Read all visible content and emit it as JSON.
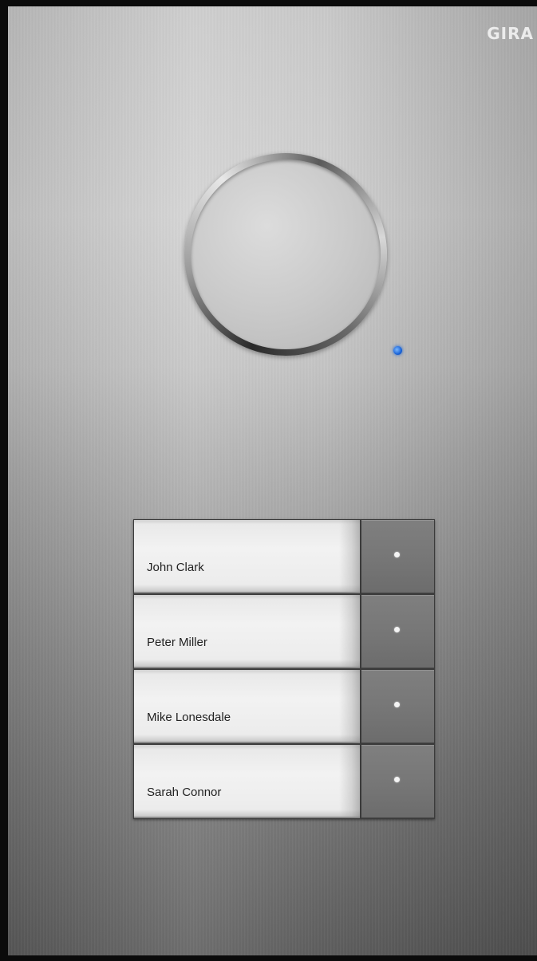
{
  "device": {
    "brand": "GIRA",
    "status_led_color": "#1a64d8"
  },
  "residents": [
    {
      "name": "John Clark"
    },
    {
      "name": "Peter Miller"
    },
    {
      "name": "Mike Lonesdale"
    },
    {
      "name": "Sarah Connor"
    }
  ]
}
